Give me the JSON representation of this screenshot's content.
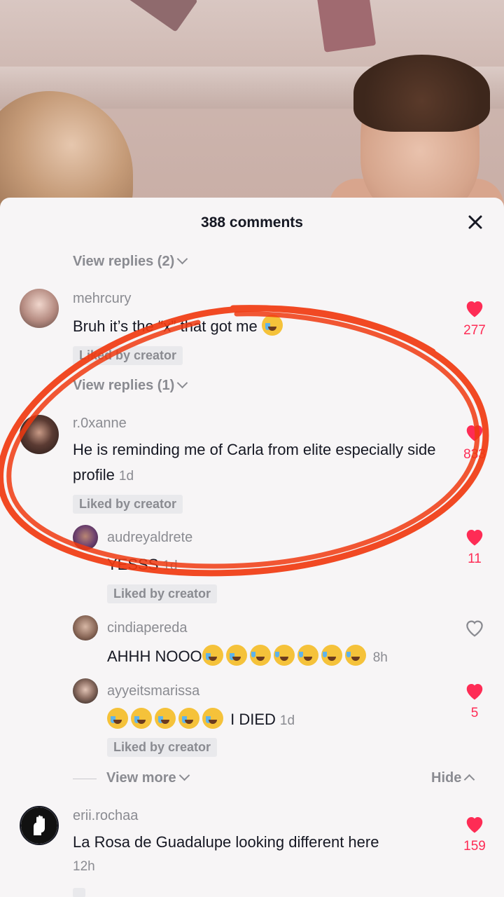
{
  "header": {
    "title": "388 comments",
    "close_icon": "close-icon"
  },
  "thread1": {
    "view_replies": "View replies (2)"
  },
  "comment1": {
    "username": "mehrcury",
    "text": "Bruh it’s the “x” that got me",
    "likes": "277",
    "badge": "Liked by creator",
    "view_replies": "View replies (1)"
  },
  "comment2": {
    "username": "r.0xanne",
    "text": "He is reminding me of Carla from elite especially side profile",
    "time": "1d",
    "likes": "833",
    "badge": "Liked by creator"
  },
  "reply1": {
    "username": "audreyaldrete",
    "text": "YESSS",
    "time": "1d",
    "likes": "11",
    "badge": "Liked by creator"
  },
  "reply2": {
    "username": "cindiapereda",
    "text": "AHHH NOOO",
    "time": "8h"
  },
  "reply3": {
    "username": "ayyeitsmarissa",
    "text": "I DIED",
    "time": "1d",
    "likes": "5",
    "badge": "Liked by creator"
  },
  "thread_controls": {
    "view_more": "View more",
    "hide": "Hide"
  },
  "comment3": {
    "username": "erii.rochaa",
    "text": "La Rosa de Guadalupe looking different here",
    "time": "12h",
    "likes": "159"
  },
  "colors": {
    "like_red": "#fe2c55",
    "annotation_orange": "#f03a10",
    "secondary_text": "#8a8b91"
  }
}
